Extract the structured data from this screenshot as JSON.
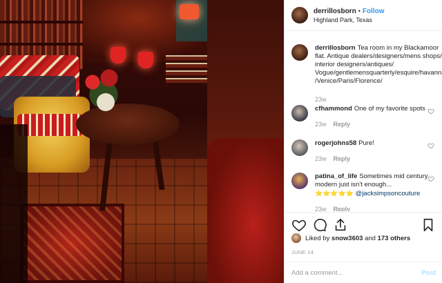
{
  "post": {
    "username": "derrillosborn",
    "follow_label": "Follow",
    "separator": "•",
    "location": "Highland Park, Texas"
  },
  "comments": [
    {
      "username": "derrillosborn",
      "text": "Tea room in my Blackamoor flat. Antique dealers/designers/mens shops/ interior designers/antiques/ Vogue/gentlemensquarterly/esquire/havanna /Venice/Paris/Florence/",
      "time": "23w"
    },
    {
      "username": "cfhammond",
      "text": "One of my favorite spots",
      "time": "23w",
      "reply": "Reply"
    },
    {
      "username": "rogerjohns58",
      "text": "Pure!",
      "time": "23w",
      "reply": "Reply"
    },
    {
      "username": "patina_of_life",
      "text": "Sometimes mid century modern just isn't enough...",
      "emoji": "⭐⭐⭐⭐⭐",
      "mention": "@jacksimpsoncouture",
      "time": "23w",
      "reply": "Reply"
    }
  ],
  "likes": {
    "prefix": "Liked by",
    "user": "snow3603",
    "middle": "and",
    "others": "173 others"
  },
  "date": "JUNE 14",
  "add_comment": {
    "placeholder": "Add a comment...",
    "post_label": "Post"
  },
  "colors": {
    "link_blue": "#3897f0",
    "post_disabled": "#b2dffc",
    "muted": "#999999"
  }
}
